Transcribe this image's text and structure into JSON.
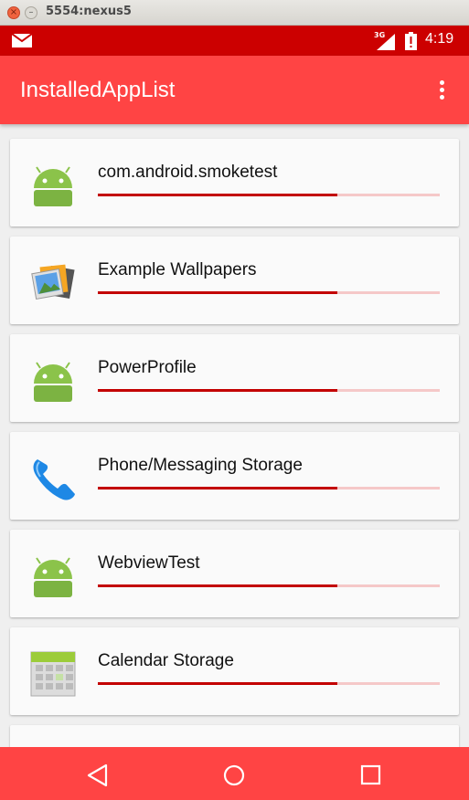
{
  "window": {
    "title": "5554:nexus5"
  },
  "status_bar": {
    "network": "3G",
    "time": "4:19",
    "color": "#cc0000"
  },
  "action_bar": {
    "title": "InstalledAppList",
    "color": "#ff4444"
  },
  "apps": [
    {
      "name": "com.android.smoketest",
      "icon": "android-icon",
      "progress": 0.7
    },
    {
      "name": "Example Wallpapers",
      "icon": "wallpapers-icon",
      "progress": 0.7
    },
    {
      "name": "PowerProfile",
      "icon": "android-icon",
      "progress": 0.7
    },
    {
      "name": "Phone/Messaging Storage",
      "icon": "phone-icon",
      "progress": 0.7
    },
    {
      "name": "WebviewTest",
      "icon": "android-icon",
      "progress": 0.7
    },
    {
      "name": "Calendar Storage",
      "icon": "calendar-icon",
      "progress": 0.7
    }
  ],
  "nav_bar": {
    "buttons": [
      "back-icon",
      "home-icon",
      "recents-icon"
    ]
  },
  "colors": {
    "progress_fill": "#c30000",
    "progress_track": "#f5c8c8",
    "android_green": "#8bc34a"
  }
}
